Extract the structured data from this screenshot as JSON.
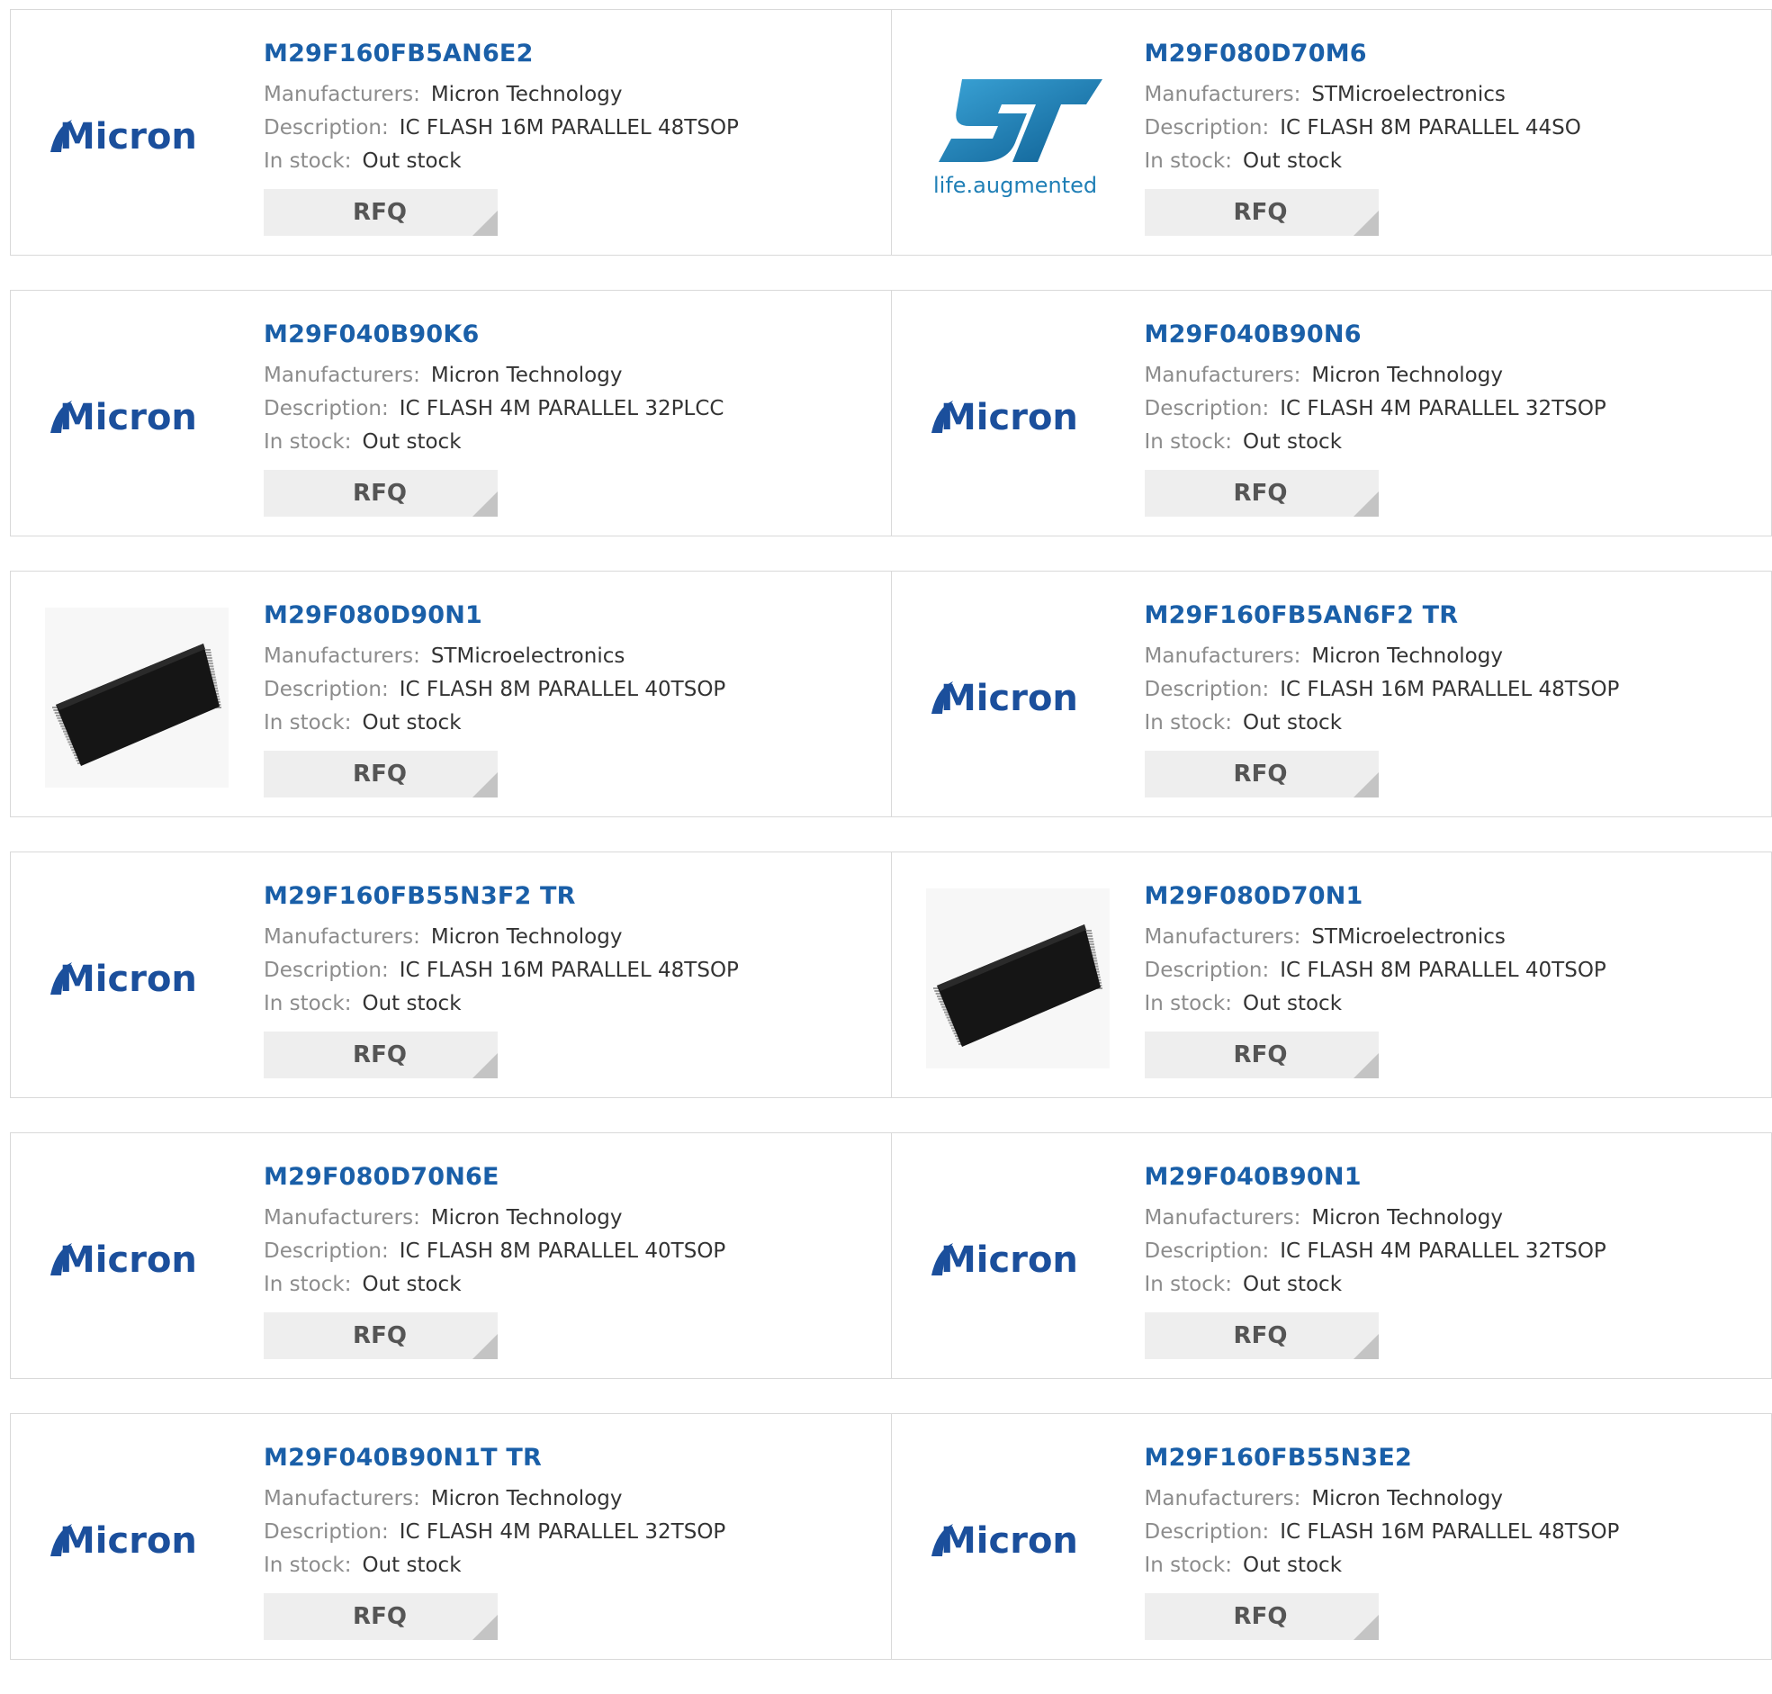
{
  "labels": {
    "manufacturers": "Manufacturers:",
    "description": "Description:",
    "in_stock": "In stock:",
    "rfq": "RFQ"
  },
  "colors": {
    "link": "#1a5fa8",
    "micron_blue": "#1b4f9c",
    "st_blue": "#1f7fb6"
  },
  "logo_text": {
    "micron": "Micron",
    "st_tagline": "life.augmented"
  },
  "products": [
    {
      "part": "M29F160FB5AN6E2",
      "manufacturer": "Micron Technology",
      "description": "IC FLASH 16M PARALLEL 48TSOP",
      "stock": "Out stock",
      "logo": "micron"
    },
    {
      "part": "M29F080D70M6",
      "manufacturer": "STMicroelectronics",
      "description": "IC FLASH 8M PARALLEL 44SO",
      "stock": "Out stock",
      "logo": "st"
    },
    {
      "part": "M29F040B90K6",
      "manufacturer": "Micron Technology",
      "description": "IC FLASH 4M PARALLEL 32PLCC",
      "stock": "Out stock",
      "logo": "micron"
    },
    {
      "part": "M29F040B90N6",
      "manufacturer": "Micron Technology",
      "description": "IC FLASH 4M PARALLEL 32TSOP",
      "stock": "Out stock",
      "logo": "micron"
    },
    {
      "part": "M29F080D90N1",
      "manufacturer": "STMicroelectronics",
      "description": "IC FLASH 8M PARALLEL 40TSOP",
      "stock": "Out stock",
      "logo": "chip"
    },
    {
      "part": "M29F160FB5AN6F2 TR",
      "manufacturer": "Micron Technology",
      "description": "IC FLASH 16M PARALLEL 48TSOP",
      "stock": "Out stock",
      "logo": "micron"
    },
    {
      "part": "M29F160FB55N3F2 TR",
      "manufacturer": "Micron Technology",
      "description": "IC FLASH 16M PARALLEL 48TSOP",
      "stock": "Out stock",
      "logo": "micron"
    },
    {
      "part": "M29F080D70N1",
      "manufacturer": "STMicroelectronics",
      "description": "IC FLASH 8M PARALLEL 40TSOP",
      "stock": "Out stock",
      "logo": "chip"
    },
    {
      "part": "M29F080D70N6E",
      "manufacturer": "Micron Technology",
      "description": "IC FLASH 8M PARALLEL 40TSOP",
      "stock": "Out stock",
      "logo": "micron"
    },
    {
      "part": "M29F040B90N1",
      "manufacturer": "Micron Technology",
      "description": "IC FLASH 4M PARALLEL 32TSOP",
      "stock": "Out stock",
      "logo": "micron"
    },
    {
      "part": "M29F040B90N1T TR",
      "manufacturer": "Micron Technology",
      "description": "IC FLASH 4M PARALLEL 32TSOP",
      "stock": "Out stock",
      "logo": "micron"
    },
    {
      "part": "M29F160FB55N3E2",
      "manufacturer": "Micron Technology",
      "description": "IC FLASH 16M PARALLEL 48TSOP",
      "stock": "Out stock",
      "logo": "micron"
    }
  ]
}
